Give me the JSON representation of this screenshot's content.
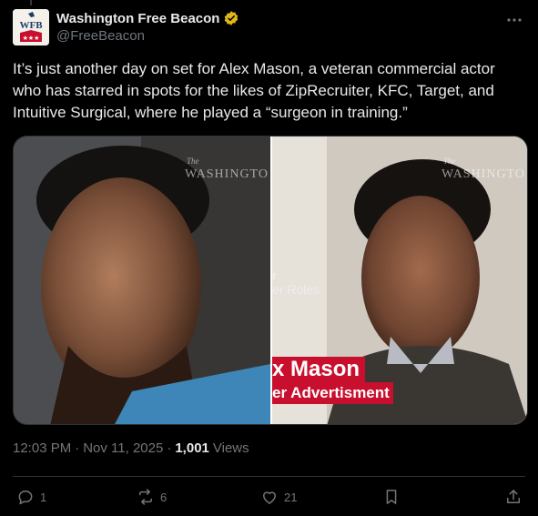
{
  "post": {
    "author": {
      "display_name": "Washington Free Beacon",
      "handle": "@FreeBeacon",
      "verified": true,
      "avatar_text": "WFB"
    },
    "text": "It’s just another day on set for Alex Mason, a veteran commercial actor who has starred in spots for the likes of ZipRecruiter, KFC, Target, and Intuitive Surgical, where he played a “surgeon in training.”",
    "media": {
      "watermark_the": "The",
      "watermark_word": "WASHINGTO",
      "overlay_role_1": "r",
      "overlay_role_2": "er Roles",
      "overlay_name": "x Mason",
      "overlay_sub": "er Advertisment"
    },
    "time": "12:03 PM",
    "dot": "·",
    "date": "Nov 11, 2025",
    "views_count": "1,001",
    "views_label": "Views"
  },
  "actions": {
    "reply_count": "1",
    "repost_count": "6",
    "like_count": "21"
  },
  "icons": {
    "verified": "verified-badge-icon",
    "more": "more-icon",
    "reply": "reply-icon",
    "repost": "repost-icon",
    "like": "like-icon",
    "bookmark": "bookmark-icon",
    "share": "share-icon"
  },
  "colors": {
    "background": "#000000",
    "text": "#e7e9ea",
    "secondary": "#71767b",
    "verified_gold": "#e2b719",
    "overlay_red": "#c8102e"
  }
}
